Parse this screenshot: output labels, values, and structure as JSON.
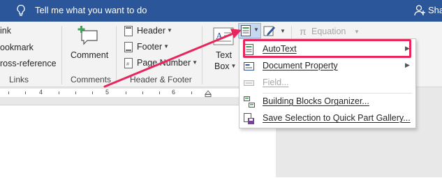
{
  "tellme": {
    "text": "Tell me what you want to do"
  },
  "account": {
    "label": "Sha"
  },
  "ribbon": {
    "links": {
      "items": [
        "ink",
        "ookmark",
        "ross-reference"
      ],
      "group_label": "Links"
    },
    "comments": {
      "comment_label": "Comment",
      "group_label": "Comments"
    },
    "header_footer": {
      "header_label": "Header",
      "footer_label": "Footer",
      "page_number_label": "Page Number",
      "group_label": "Header & Footer"
    },
    "text": {
      "textbox_label_1": "Text",
      "textbox_label_2": "Box"
    },
    "symbols": {
      "equation_label": "Equation"
    }
  },
  "ruler": {
    "numbers": [
      "4",
      "5",
      "6"
    ]
  },
  "quick_parts_menu": {
    "items": [
      {
        "label": "AutoText",
        "has_submenu": true,
        "disabled": false,
        "icon": "autotext-icon"
      },
      {
        "label": "Document Property",
        "has_submenu": true,
        "disabled": false,
        "icon": "document-property-icon"
      },
      {
        "label": "Field...",
        "has_submenu": false,
        "disabled": true,
        "icon": "field-icon"
      },
      {
        "label": "Building Blocks Organizer...",
        "has_submenu": false,
        "disabled": false,
        "icon": "building-blocks-icon"
      },
      {
        "label": "Save Selection to Quick Part Gallery...",
        "has_submenu": false,
        "disabled": false,
        "icon": "save-selection-icon"
      }
    ]
  },
  "colors": {
    "title_bar": "#2b579a",
    "highlight": "#e8265c",
    "ribbon_bg": "#f3f3f3"
  }
}
